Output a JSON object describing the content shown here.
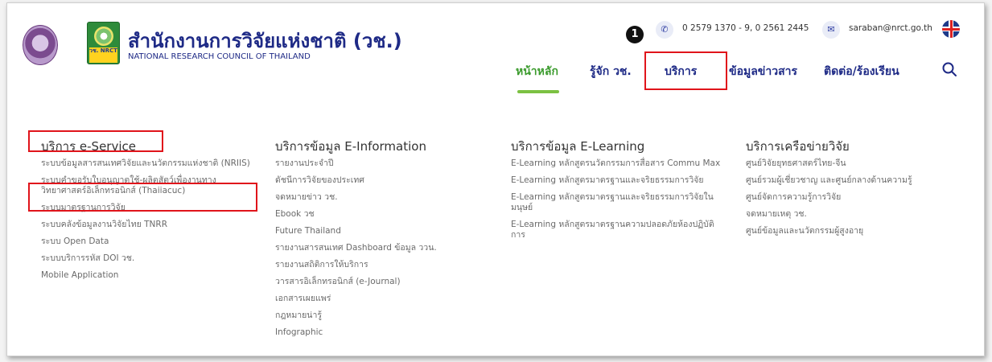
{
  "header": {
    "org_name_th": "สำนักงานการวิจัยแห่งชาติ (วช.)",
    "org_name_en": "NATIONAL RESEARCH COUNCIL OF THAILAND",
    "logo_text": "วช. NRCT",
    "phone": "0 2579 1370 - 9, 0 2561 2445",
    "email": "saraban@nrct.go.th",
    "step_badge": "1"
  },
  "nav": {
    "home": "หน้าหลัก",
    "about": "รู้จัก วช.",
    "services": "บริการ",
    "news": "ข้อมูลข่าวสาร",
    "contact": "ติดต่อ/ร้องเรียน"
  },
  "columns": [
    {
      "heading": "บริการ e-Service",
      "items": [
        "ระบบข้อมูลสารสนเทศวิจัยและนวัตกรรมแห่งชาติ (NRIIS)",
        "ระบบคำขอรับใบอนุญาตใช้-ผลิตสัตว์เพื่องานทางวิทยาศาสตร์อิเล็กทรอนิกส์ (Thaiiacuc)",
        "ระบบมาตรฐานการวิจัย",
        "ระบบคลังข้อมูลงานวิจัยไทย TNRR",
        "ระบบ Open Data",
        "ระบบบริการรหัส DOI วช.",
        "Mobile Application"
      ]
    },
    {
      "heading": "บริการข้อมูล E-Information",
      "items": [
        "รายงานประจำปี",
        "ดัชนีการวิจัยของประเทศ",
        "จดหมายข่าว วช.",
        "Ebook วช",
        "Future Thailand",
        "รายงานสารสนเทศ Dashboard ข้อมูล ววน.",
        "รายงานสถิติการให้บริการ",
        "วารสารอิเล็กทรอนิกส์ (e-Journal)",
        "เอกสารเผยแพร่",
        "กฎหมายน่ารู้",
        "Infographic"
      ]
    },
    {
      "heading": "บริการข้อมูล E-Learning",
      "items": [
        "E-Learning หลักสูตรนวัตกรรมการสื่อสาร Commu Max",
        "E-Learning หลักสูตรมาตรฐานและจริยธรรมการวิจัย",
        "E-Learning หลักสูตรมาตรฐานและจริยธรรมการวิจัยในมนุษย์",
        "E-Learning หลักสูตรมาตรฐานความปลอดภัยห้องปฏิบัติการ"
      ]
    },
    {
      "heading": "บริการเครือข่ายวิจัย",
      "items": [
        "ศูนย์วิจัยยุทธศาสตร์ไทย-จีน",
        "ศูนย์รวมผู้เชี่ยวชาญ และศูนย์กลางด้านความรู้",
        "ศูนย์จัดการความรู้การวิจัย",
        "จดหมายเหตุ วช.",
        "ศูนย์ข้อมูลและนวัตกรรมผู้สูงอายุ"
      ]
    }
  ],
  "colors": {
    "brand_navy": "#1e2a86",
    "active_green": "#3b9b2d",
    "highlight_red": "#e0141b"
  }
}
